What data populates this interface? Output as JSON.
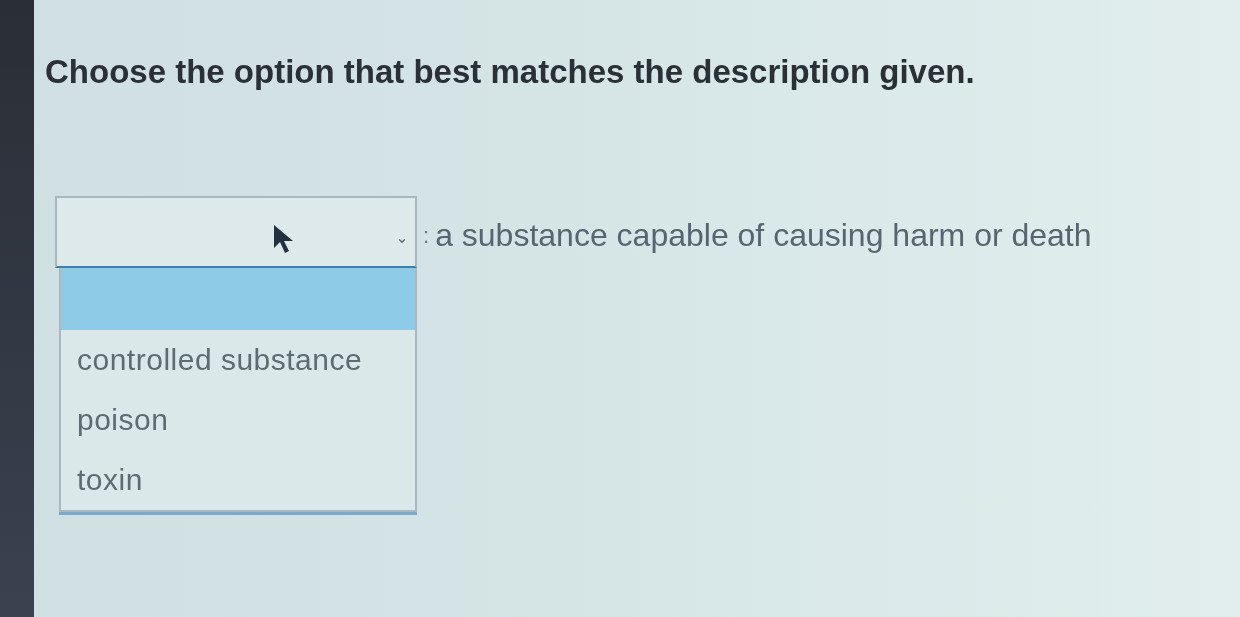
{
  "instruction": "Choose the option that best matches the description given.",
  "question": {
    "dropdown": {
      "expanded": true,
      "options": [
        {
          "selected": true
        },
        {
          "label": "controlled substance",
          "selected": false
        },
        {
          "label": "poison",
          "selected": false
        },
        {
          "label": "toxin",
          "selected": false
        }
      ]
    },
    "separator": ":",
    "description": "a substance capable of causing harm or death"
  }
}
